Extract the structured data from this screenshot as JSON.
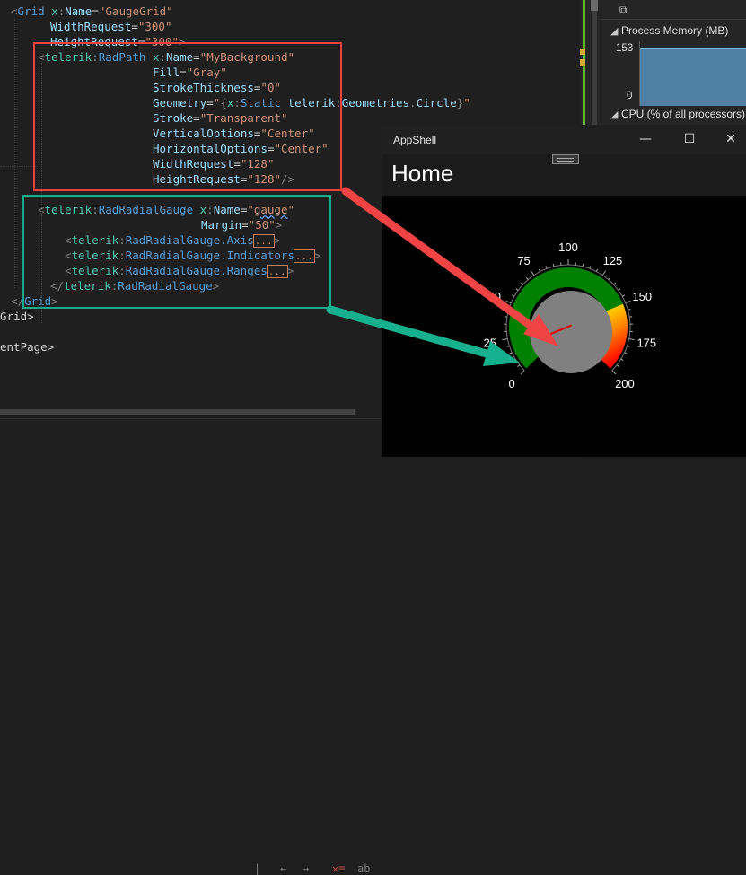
{
  "editor": {
    "lines": [
      {
        "indent": 0,
        "tokens": [
          [
            "punc",
            "<"
          ],
          [
            "tag",
            "Grid "
          ],
          [
            "ns",
            "x"
          ],
          [
            "punc",
            ":"
          ],
          [
            "attr",
            "Name"
          ],
          [
            "def",
            "="
          ],
          [
            "val",
            "\"GaugeGrid\""
          ]
        ]
      },
      {
        "indent": 1,
        "tokens": [
          [
            "attr",
            "WidthRequest"
          ],
          [
            "def",
            "="
          ],
          [
            "val",
            "\"300\""
          ]
        ]
      },
      {
        "indent": 1,
        "tokens": [
          [
            "attr",
            "HeightRequest"
          ],
          [
            "def",
            "="
          ],
          [
            "val",
            "\"300\""
          ],
          [
            "punc",
            ">"
          ]
        ]
      },
      {
        "indent": 1,
        "tokens": [
          [
            "punc",
            "<"
          ],
          [
            "ns",
            "telerik"
          ],
          [
            "punc",
            ":"
          ],
          [
            "tag",
            "RadPath "
          ],
          [
            "ns",
            "x"
          ],
          [
            "punc",
            ":"
          ],
          [
            "attr",
            "Name"
          ],
          [
            "def",
            "="
          ],
          [
            "val",
            "\"MyBackground\""
          ]
        ]
      },
      {
        "indent": 2,
        "tokens": [
          [
            "attr",
            "Fill"
          ],
          [
            "def",
            "="
          ],
          [
            "val",
            "\"Gray\""
          ]
        ]
      },
      {
        "indent": 2,
        "tokens": [
          [
            "attr",
            "StrokeThickness"
          ],
          [
            "def",
            "="
          ],
          [
            "val",
            "\"0\""
          ]
        ]
      },
      {
        "indent": 2,
        "tokens": [
          [
            "attr",
            "Geometry"
          ],
          [
            "def",
            "="
          ],
          [
            "val",
            "\""
          ],
          [
            "punc",
            "{"
          ],
          [
            "ns",
            "x"
          ],
          [
            "punc",
            ":"
          ],
          [
            "tag",
            "Static "
          ],
          [
            "attr",
            "telerik"
          ],
          [
            "punc",
            ":"
          ],
          [
            "attr",
            "Geometries"
          ],
          [
            "punc",
            "."
          ],
          [
            "attr",
            "Circle"
          ],
          [
            "punc",
            "}"
          ],
          [
            "val",
            "\""
          ]
        ]
      },
      {
        "indent": 2,
        "tokens": [
          [
            "attr",
            "Stroke"
          ],
          [
            "def",
            "="
          ],
          [
            "val",
            "\"Transparent\""
          ]
        ]
      },
      {
        "indent": 2,
        "tokens": [
          [
            "attr",
            "VerticalOptions"
          ],
          [
            "def",
            "="
          ],
          [
            "val",
            "\"Center\""
          ]
        ]
      },
      {
        "indent": 2,
        "tokens": [
          [
            "attr",
            "HorizontalOptions"
          ],
          [
            "def",
            "="
          ],
          [
            "val",
            "\"Center\""
          ]
        ]
      },
      {
        "indent": 2,
        "tokens": [
          [
            "attr",
            "WidthRequest"
          ],
          [
            "def",
            "="
          ],
          [
            "val",
            "\"128\""
          ]
        ]
      },
      {
        "indent": 2,
        "tokens": [
          [
            "attr",
            "HeightRequest"
          ],
          [
            "def",
            "="
          ],
          [
            "val",
            "\"128\""
          ],
          [
            "punc",
            "/>"
          ]
        ]
      },
      {
        "indent": 0,
        "tokens": []
      },
      {
        "indent": 1,
        "tokens": [
          [
            "punc",
            "<"
          ],
          [
            "ns",
            "telerik"
          ],
          [
            "punc",
            ":"
          ],
          [
            "tag",
            "RadRadialGauge "
          ],
          [
            "ns",
            "x"
          ],
          [
            "punc",
            ":"
          ],
          [
            "attr",
            "Name"
          ],
          [
            "def",
            "="
          ],
          [
            "val",
            "\""
          ],
          [
            "squig",
            "gauge"
          ],
          [
            "val",
            "\""
          ]
        ]
      },
      {
        "indent": 3,
        "tokens": [
          [
            "attr",
            "Margin"
          ],
          [
            "def",
            "="
          ],
          [
            "val",
            "\"50\""
          ],
          [
            "punc",
            ">"
          ]
        ]
      },
      {
        "indent": 4,
        "tokens": [
          [
            "punc",
            "<"
          ],
          [
            "ns",
            "telerik"
          ],
          [
            "punc",
            ":"
          ],
          [
            "tag",
            "RadRadialGauge.Axis"
          ],
          [
            "box",
            "..."
          ],
          [
            "punc",
            ">"
          ]
        ]
      },
      {
        "indent": 4,
        "tokens": [
          [
            "punc",
            "<"
          ],
          [
            "ns",
            "telerik"
          ],
          [
            "punc",
            ":"
          ],
          [
            "tag",
            "RadRadialGauge.Indicators"
          ],
          [
            "box",
            "..."
          ],
          [
            "punc",
            ">"
          ]
        ]
      },
      {
        "indent": 4,
        "tokens": [
          [
            "punc",
            "<"
          ],
          [
            "ns",
            "telerik"
          ],
          [
            "punc",
            ":"
          ],
          [
            "tag",
            "RadRadialGauge.Ranges"
          ],
          [
            "box",
            "..."
          ],
          [
            "punc",
            ">"
          ]
        ]
      },
      {
        "indent": 1,
        "tokens": [
          [
            "punc",
            "</"
          ],
          [
            "ns",
            "telerik"
          ],
          [
            "punc",
            ":"
          ],
          [
            "tag",
            "RadRadialGauge"
          ],
          [
            "punc",
            ">"
          ]
        ]
      },
      {
        "indent": 0,
        "tokens": [
          [
            "punc",
            "</"
          ],
          [
            "tag",
            "Grid"
          ],
          [
            "punc",
            ">"
          ]
        ]
      },
      {
        "indent": 0,
        "tokens": [
          [
            "text",
            "Grid>"
          ]
        ]
      },
      {
        "indent": 0,
        "tokens": []
      },
      {
        "indent": 0,
        "tokens": [
          [
            "text",
            "entPage>"
          ]
        ]
      }
    ]
  },
  "diagnostics": {
    "process_memory_label": "Process Memory (MB)",
    "memory_max": "153",
    "memory_min": "0",
    "cpu_label": "CPU (% of all processors)"
  },
  "appshell": {
    "window_title": "AppShell",
    "page_title": "Home",
    "minimize_glyph": "—",
    "maximize_glyph": "☐",
    "close_glyph": "✕"
  },
  "gauge": {
    "min": 0,
    "max": 200,
    "tick_labels": [
      "0",
      "25",
      "50",
      "75",
      "100",
      "125",
      "150",
      "175",
      "200"
    ],
    "needle_value": 150,
    "ranges": [
      {
        "from": 0,
        "to": 150,
        "color": "#008000"
      },
      {
        "from": 150,
        "to": 200,
        "gradient": [
          "#ffff00",
          "#ff8c00",
          "#ff0000"
        ]
      }
    ],
    "background_fill": "#808080",
    "needle_color": "#e00000"
  },
  "colors": {
    "red_box": "#ef4040",
    "teal_box": "#18a88a",
    "red_arrow": "#f04444",
    "teal_arrow": "#17b08e",
    "progress_green": "#5cb832"
  }
}
